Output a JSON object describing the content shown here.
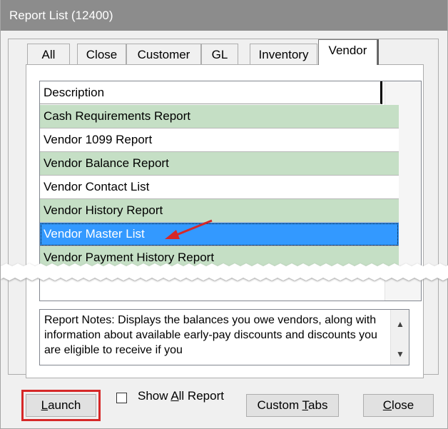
{
  "window": {
    "title": "Report List (12400)"
  },
  "tabs": [
    {
      "label": "All",
      "active": false
    },
    {
      "label": "Close",
      "active": false
    },
    {
      "label": "Customer",
      "active": false
    },
    {
      "label": "GL",
      "active": false
    },
    {
      "label": "Inventory",
      "active": false
    },
    {
      "label": "Vendor",
      "active": true
    }
  ],
  "list": {
    "header": "Description",
    "rows": [
      {
        "label": "Cash Requirements Report",
        "style": "green"
      },
      {
        "label": "Vendor 1099 Report",
        "style": "white"
      },
      {
        "label": "Vendor Balance Report",
        "style": "green"
      },
      {
        "label": "Vendor Contact List",
        "style": "white"
      },
      {
        "label": "Vendor History Report",
        "style": "green"
      },
      {
        "label": "Vendor Master List",
        "style": "selected"
      },
      {
        "label": "Vendor Payment History Report",
        "style": "green"
      }
    ]
  },
  "notes": {
    "text": "Report Notes:  Displays the balances you owe vendors, along with information about available early-pay discounts and discounts you are eligible to receive if you"
  },
  "buttons": {
    "launch": {
      "prefix": "",
      "accel": "L",
      "suffix": "aunch"
    },
    "show_all": {
      "prefix": "Show ",
      "accel": "A",
      "suffix": "ll Report"
    },
    "custom_tabs": {
      "prefix": "Custom ",
      "accel": "T",
      "suffix": "abs"
    },
    "close": {
      "prefix": "",
      "accel": "C",
      "suffix": "lose"
    }
  },
  "colors": {
    "row_green": "#c5dfc5",
    "selected": "#3399ff",
    "annotation": "#d62828"
  },
  "icons": [
    "red-arrow-icon",
    "scroll-up-arrow-icon",
    "scroll-down-arrow-icon"
  ]
}
